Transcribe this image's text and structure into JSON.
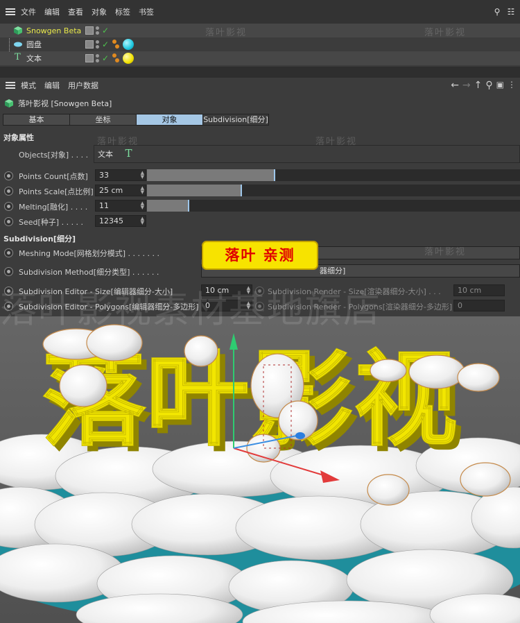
{
  "object_manager": {
    "menu": [
      "文件",
      "编辑",
      "查看",
      "对象",
      "标签",
      "书签"
    ],
    "objects": [
      {
        "name": "Snowgen Beta",
        "color": "#e8e84a",
        "icon": "snowgen-cube-icon",
        "tag": "none"
      },
      {
        "name": "圆盘",
        "color": "#dddddd",
        "icon": "disc-icon",
        "tag": "cyan-material",
        "tag_color": "#1ec8e0"
      },
      {
        "name": "文本",
        "color": "#dddddd",
        "icon": "text-t-icon",
        "tag": "yellow-material",
        "tag_color": "#f2e200"
      }
    ]
  },
  "attribute_manager": {
    "menu": [
      "模式",
      "编辑",
      "用户数据"
    ],
    "nav_icons": [
      "arrow-left-icon",
      "arrow-right-icon",
      "arrow-up-icon",
      "search-icon",
      "lock-icon",
      "settings-icon"
    ],
    "title": "落叶影视 [Snowgen Beta]",
    "tabs": [
      "基本",
      "坐标",
      "对象",
      "Subdivision[细分]"
    ],
    "active_tab": "对象",
    "object_section": {
      "title": "对象属性",
      "objects_label": "Objects[对象] . . . .",
      "objects_value": "文本",
      "points_count_label": "Points Count[点数]",
      "points_count_value": "33",
      "points_count_fraction": 0.34,
      "points_scale_label": "Points Scale[点比例]",
      "points_scale_value": "25 cm",
      "points_scale_fraction": 0.25,
      "melting_label": "Melting[融化] . . . .",
      "melting_value": "11",
      "melting_fraction": 0.11,
      "seed_label": "Seed[种子] . . . . .",
      "seed_value": "12345"
    },
    "subdivision_section": {
      "title": "Subdivision[细分]",
      "meshing_label": "Meshing Mode[网格划分模式] . . . . . . .",
      "method_label": "Subdivision Method[细分类型] . . . . . .",
      "method_value_visible": "器细分]",
      "editor_size_label": "Subdivision Editor - Size[编辑器细分-大小]",
      "editor_size_value": "10 cm",
      "editor_poly_label": "Subdivision Editor - Polygons[编辑器细分-多边形]",
      "editor_poly_value": "0",
      "render_size_label": "Subdivision Render - Size[渲染器细分-大小] . . .",
      "render_size_value": "10 cm",
      "render_poly_label": "Subdivision Render - Polygons[渲染器细分-多边形]",
      "render_poly_value": "0"
    }
  },
  "overlay": {
    "badge": "落叶 亲测",
    "watermark_small": "落叶影视",
    "watermark_large": "落叶影视素材基地旗店"
  },
  "viewport": {
    "text_color": "#f2e600",
    "snow_color": "#f4f4f4",
    "disc_color": "#1f8e9c",
    "scene_text": "落叶影视"
  }
}
